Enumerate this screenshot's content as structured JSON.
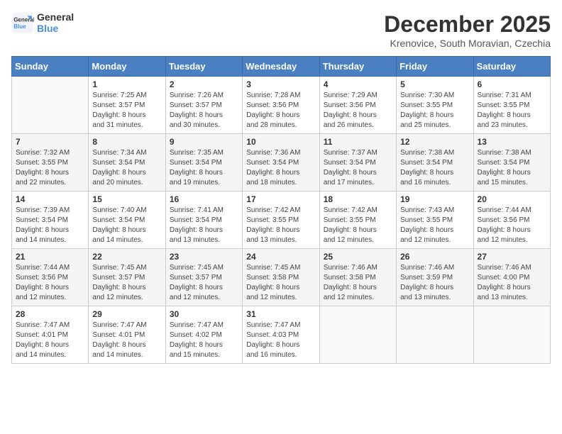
{
  "header": {
    "logo_line1": "General",
    "logo_line2": "Blue",
    "month": "December 2025",
    "location": "Krenovice, South Moravian, Czechia"
  },
  "weekdays": [
    "Sunday",
    "Monday",
    "Tuesday",
    "Wednesday",
    "Thursday",
    "Friday",
    "Saturday"
  ],
  "weeks": [
    [
      {
        "day": "",
        "info": ""
      },
      {
        "day": "1",
        "info": "Sunrise: 7:25 AM\nSunset: 3:57 PM\nDaylight: 8 hours\nand 31 minutes."
      },
      {
        "day": "2",
        "info": "Sunrise: 7:26 AM\nSunset: 3:57 PM\nDaylight: 8 hours\nand 30 minutes."
      },
      {
        "day": "3",
        "info": "Sunrise: 7:28 AM\nSunset: 3:56 PM\nDaylight: 8 hours\nand 28 minutes."
      },
      {
        "day": "4",
        "info": "Sunrise: 7:29 AM\nSunset: 3:56 PM\nDaylight: 8 hours\nand 26 minutes."
      },
      {
        "day": "5",
        "info": "Sunrise: 7:30 AM\nSunset: 3:55 PM\nDaylight: 8 hours\nand 25 minutes."
      },
      {
        "day": "6",
        "info": "Sunrise: 7:31 AM\nSunset: 3:55 PM\nDaylight: 8 hours\nand 23 minutes."
      }
    ],
    [
      {
        "day": "7",
        "info": "Sunrise: 7:32 AM\nSunset: 3:55 PM\nDaylight: 8 hours\nand 22 minutes."
      },
      {
        "day": "8",
        "info": "Sunrise: 7:34 AM\nSunset: 3:54 PM\nDaylight: 8 hours\nand 20 minutes."
      },
      {
        "day": "9",
        "info": "Sunrise: 7:35 AM\nSunset: 3:54 PM\nDaylight: 8 hours\nand 19 minutes."
      },
      {
        "day": "10",
        "info": "Sunrise: 7:36 AM\nSunset: 3:54 PM\nDaylight: 8 hours\nand 18 minutes."
      },
      {
        "day": "11",
        "info": "Sunrise: 7:37 AM\nSunset: 3:54 PM\nDaylight: 8 hours\nand 17 minutes."
      },
      {
        "day": "12",
        "info": "Sunrise: 7:38 AM\nSunset: 3:54 PM\nDaylight: 8 hours\nand 16 minutes."
      },
      {
        "day": "13",
        "info": "Sunrise: 7:38 AM\nSunset: 3:54 PM\nDaylight: 8 hours\nand 15 minutes."
      }
    ],
    [
      {
        "day": "14",
        "info": "Sunrise: 7:39 AM\nSunset: 3:54 PM\nDaylight: 8 hours\nand 14 minutes."
      },
      {
        "day": "15",
        "info": "Sunrise: 7:40 AM\nSunset: 3:54 PM\nDaylight: 8 hours\nand 14 minutes."
      },
      {
        "day": "16",
        "info": "Sunrise: 7:41 AM\nSunset: 3:54 PM\nDaylight: 8 hours\nand 13 minutes."
      },
      {
        "day": "17",
        "info": "Sunrise: 7:42 AM\nSunset: 3:55 PM\nDaylight: 8 hours\nand 13 minutes."
      },
      {
        "day": "18",
        "info": "Sunrise: 7:42 AM\nSunset: 3:55 PM\nDaylight: 8 hours\nand 12 minutes."
      },
      {
        "day": "19",
        "info": "Sunrise: 7:43 AM\nSunset: 3:55 PM\nDaylight: 8 hours\nand 12 minutes."
      },
      {
        "day": "20",
        "info": "Sunrise: 7:44 AM\nSunset: 3:56 PM\nDaylight: 8 hours\nand 12 minutes."
      }
    ],
    [
      {
        "day": "21",
        "info": "Sunrise: 7:44 AM\nSunset: 3:56 PM\nDaylight: 8 hours\nand 12 minutes."
      },
      {
        "day": "22",
        "info": "Sunrise: 7:45 AM\nSunset: 3:57 PM\nDaylight: 8 hours\nand 12 minutes."
      },
      {
        "day": "23",
        "info": "Sunrise: 7:45 AM\nSunset: 3:57 PM\nDaylight: 8 hours\nand 12 minutes."
      },
      {
        "day": "24",
        "info": "Sunrise: 7:45 AM\nSunset: 3:58 PM\nDaylight: 8 hours\nand 12 minutes."
      },
      {
        "day": "25",
        "info": "Sunrise: 7:46 AM\nSunset: 3:58 PM\nDaylight: 8 hours\nand 12 minutes."
      },
      {
        "day": "26",
        "info": "Sunrise: 7:46 AM\nSunset: 3:59 PM\nDaylight: 8 hours\nand 13 minutes."
      },
      {
        "day": "27",
        "info": "Sunrise: 7:46 AM\nSunset: 4:00 PM\nDaylight: 8 hours\nand 13 minutes."
      }
    ],
    [
      {
        "day": "28",
        "info": "Sunrise: 7:47 AM\nSunset: 4:01 PM\nDaylight: 8 hours\nand 14 minutes."
      },
      {
        "day": "29",
        "info": "Sunrise: 7:47 AM\nSunset: 4:01 PM\nDaylight: 8 hours\nand 14 minutes."
      },
      {
        "day": "30",
        "info": "Sunrise: 7:47 AM\nSunset: 4:02 PM\nDaylight: 8 hours\nand 15 minutes."
      },
      {
        "day": "31",
        "info": "Sunrise: 7:47 AM\nSunset: 4:03 PM\nDaylight: 8 hours\nand 16 minutes."
      },
      {
        "day": "",
        "info": ""
      },
      {
        "day": "",
        "info": ""
      },
      {
        "day": "",
        "info": ""
      }
    ]
  ]
}
